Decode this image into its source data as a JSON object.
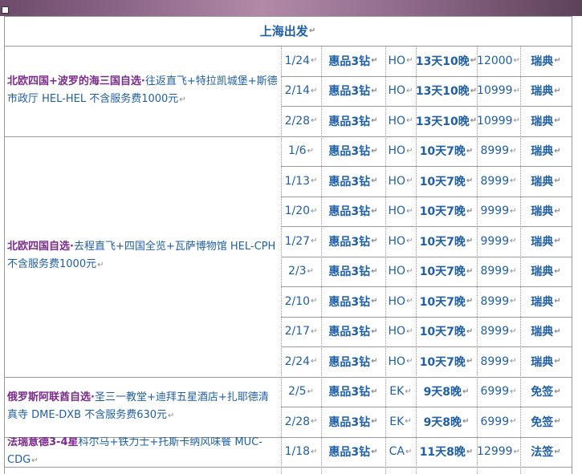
{
  "header": {
    "title": "上海出发"
  },
  "paragraph_mark": "↵",
  "groups": [
    {
      "title": "北欧四国+波罗的海三国自选·",
      "detail": "往返直飞+特拉凯城堡+斯德市政厅 HEL-HEL 不含服务费1000元",
      "rows": [
        {
          "date": "1/24",
          "product": "惠品3钻",
          "airline": "HO",
          "duration": "13天10晚",
          "price": "12000",
          "visa": "瑞典"
        },
        {
          "date": "2/14",
          "product": "惠品3钻",
          "airline": "HO",
          "duration": "13天10晚",
          "price": "10999",
          "visa": "瑞典"
        },
        {
          "date": "2/28",
          "product": "惠品3钻",
          "airline": "HO",
          "duration": "13天10晚",
          "price": "10999",
          "visa": "瑞典"
        }
      ]
    },
    {
      "title": "北欧四国自选·",
      "detail": "去程直飞+四国全览+瓦萨博物馆 HEL-CPH 不含服务费1000元",
      "rows": [
        {
          "date": "1/6",
          "product": "惠品3钻",
          "airline": "HO",
          "duration": "10天7晚",
          "price": "8999",
          "visa": "瑞典"
        },
        {
          "date": "1/13",
          "product": "惠品3钻",
          "airline": "HO",
          "duration": "10天7晚",
          "price": "8999",
          "visa": "瑞典"
        },
        {
          "date": "1/20",
          "product": "惠品3钻",
          "airline": "HO",
          "duration": "10天7晚",
          "price": "9999",
          "visa": "瑞典"
        },
        {
          "date": "1/27",
          "product": "惠品3钻",
          "airline": "HO",
          "duration": "10天7晚",
          "price": "9999",
          "visa": "瑞典"
        },
        {
          "date": "2/3",
          "product": "惠品3钻",
          "airline": "HO",
          "duration": "10天7晚",
          "price": "8999",
          "visa": "瑞典"
        },
        {
          "date": "2/10",
          "product": "惠品3钻",
          "airline": "HO",
          "duration": "10天7晚",
          "price": "8999",
          "visa": "瑞典"
        },
        {
          "date": "2/17",
          "product": "惠品3钻",
          "airline": "HO",
          "duration": "10天7晚",
          "price": "8999",
          "visa": "瑞典"
        },
        {
          "date": "2/24",
          "product": "惠品3钻",
          "airline": "HO",
          "duration": "10天7晚",
          "price": "8999",
          "visa": "瑞典"
        }
      ]
    },
    {
      "title": "俄罗斯阿联酋自选·",
      "detail": "圣三一教堂+迪拜五星酒店+扎耶德清真寺 DME-DXB 不含服务费630元",
      "rows": [
        {
          "date": "2/5",
          "product": "惠品3钻",
          "airline": "EK",
          "duration": "9天8晚",
          "price": "6999",
          "visa": "免签"
        },
        {
          "date": "2/28",
          "product": "惠品3钻",
          "airline": "EK",
          "duration": "9天8晚",
          "price": "6999",
          "visa": "免签"
        }
      ]
    },
    {
      "title": "法瑞意德3-4星",
      "detail": "科尔马+铁力士+托斯卡纳风味餐 MUC-CDG",
      "rows": [
        {
          "date": "1/18",
          "product": "惠品3钻",
          "airline": "CA",
          "duration": "11天8晚",
          "price": "12999",
          "visa": "法签"
        }
      ]
    }
  ],
  "colors": {
    "accent": "#1f5fa8",
    "title": "#7b2a8c",
    "grid": "#9a9a9a"
  }
}
